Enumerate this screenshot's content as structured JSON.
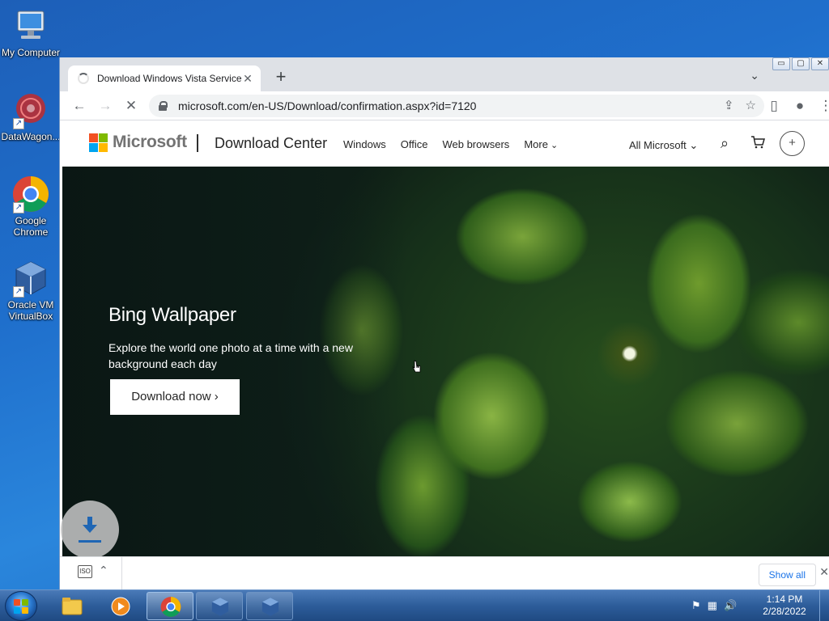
{
  "desktop": {
    "icons": [
      {
        "label": "My Computer"
      },
      {
        "label": "DataWagon..."
      },
      {
        "label": "Google Chrome"
      },
      {
        "label": "Oracle VM VirtualBox"
      }
    ]
  },
  "window_controls": {
    "minimize": "▭",
    "maximize": "▢",
    "close": "✕"
  },
  "browser": {
    "tab_title": "Download Windows Vista Service",
    "tab_close": "✕",
    "new_tab": "+",
    "tab_menu": "⌄",
    "url": "microsoft.com/en-US/Download/confirmation.aspx?id=7120",
    "back": "←",
    "forward": "→",
    "stop": "✕"
  },
  "ms_header": {
    "brand": "Microsoft",
    "section": "Download Center",
    "nav": [
      "Windows",
      "Office",
      "Web browsers",
      "More"
    ],
    "all_microsoft": "All Microsoft ⌄",
    "logo_colors": [
      "#f25022",
      "#7fba00",
      "#00a4ef",
      "#ffb900"
    ]
  },
  "hero": {
    "title": "Bing Wallpaper",
    "description": "Explore the world one photo at a time with a new background each day",
    "button": "Download now ›"
  },
  "download_shelf": {
    "file_icon_text": "ISO",
    "show_all": "Show all",
    "close": "✕"
  },
  "taskbar": {
    "time": "1:14 PM",
    "date": "2/28/2022",
    "items": [
      "windows-explorer",
      "windows-media-player",
      "google-chrome",
      "virtualbox",
      "virtualbox"
    ]
  }
}
